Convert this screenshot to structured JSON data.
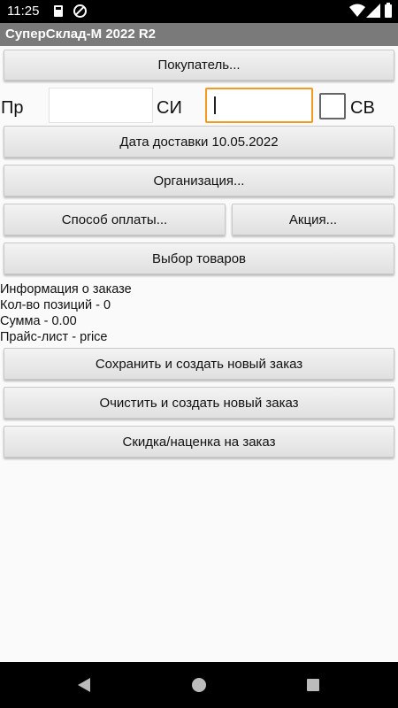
{
  "status_bar": {
    "time": "11:25"
  },
  "app": {
    "title": "СуперСклад-М 2022 R2"
  },
  "form": {
    "buyer_button": "Покупатель...",
    "label_pr": "Пр",
    "label_si": "СИ",
    "label_sv": "СВ",
    "pr_value": "",
    "si_value": "",
    "sv_checked": false,
    "delivery_date_button": "Дата доставки 10.05.2022",
    "organization_button": "Организация...",
    "payment_method_button": "Способ оплаты...",
    "promo_button": "Акция...",
    "select_goods_button": "Выбор товаров"
  },
  "order_info": {
    "heading": "Информация о заказе",
    "positions": "Кол-во позиций - 0",
    "sum": "Сумма - 0.00",
    "price_list": "Прайс-лист - price"
  },
  "actions": {
    "save_new": "Сохранить и создать новый заказ",
    "clear_new": "Очистить и создать новый заказ",
    "discount": "Скидка/наценка на заказ"
  },
  "icons": {
    "sd_card": "sd-card-icon",
    "data_saver": "data-saver-icon",
    "wifi": "wifi-icon",
    "signal": "cellular-signal-icon",
    "battery": "battery-icon",
    "back": "back-icon",
    "home": "home-icon",
    "recents": "recents-icon"
  },
  "colors": {
    "title_bar": "#7a7a7a",
    "focus": "#f29a22"
  }
}
